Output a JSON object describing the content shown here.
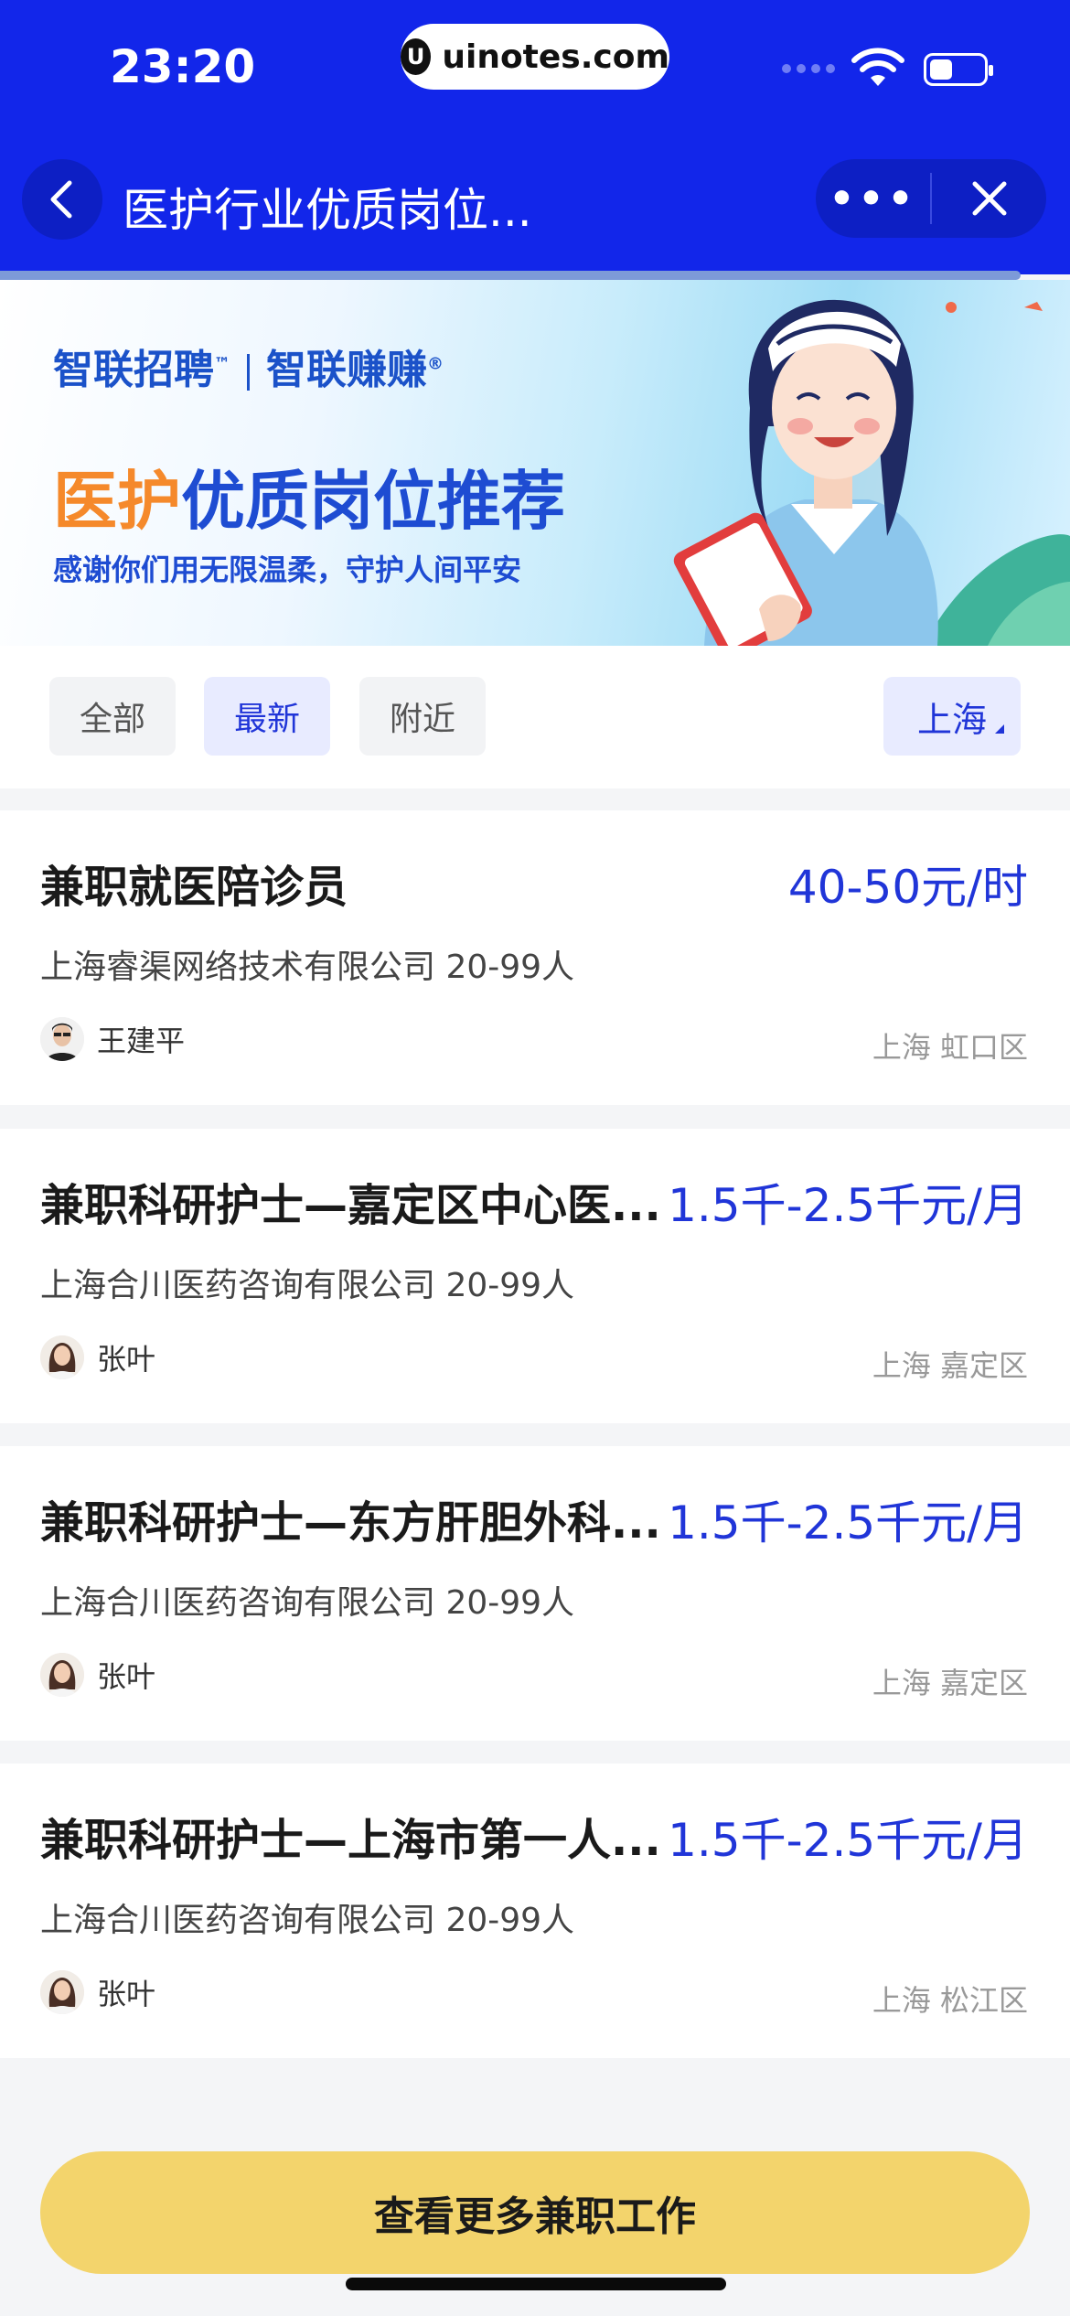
{
  "status_bar": {
    "time": "23:20",
    "url": "uinotes.com",
    "url_logo": "U"
  },
  "nav": {
    "title": "医护行业优质岗位...",
    "more_label": "•••"
  },
  "banner": {
    "logo_left": "智联招聘",
    "logo_left_mark": "™",
    "logo_right": "智联赚赚",
    "logo_right_mark": "®",
    "title_accent": "医护",
    "title_rest": "优质岗位推荐",
    "subtitle": "感谢你们用无限温柔，守护人间平安"
  },
  "filters": {
    "tabs": [
      {
        "label": "全部",
        "active": false
      },
      {
        "label": "最新",
        "active": true
      },
      {
        "label": "附近",
        "active": false
      }
    ],
    "city": "上海"
  },
  "jobs": [
    {
      "title": "兼职就医陪诊员",
      "salary": "40-50元/时",
      "company": "上海睿渠网络技术有限公司  20-99人",
      "recruiter": "王建平",
      "location": "上海 虹口区"
    },
    {
      "title": "兼职科研护士—嘉定区中心医...",
      "salary": "1.5千-2.5千元/月",
      "company": "上海合川医药咨询有限公司  20-99人",
      "recruiter": "张叶",
      "location": "上海 嘉定区"
    },
    {
      "title": "兼职科研护士—东方肝胆外科...",
      "salary": "1.5千-2.5千元/月",
      "company": "上海合川医药咨询有限公司  20-99人",
      "recruiter": "张叶",
      "location": "上海 嘉定区"
    },
    {
      "title": "兼职科研护士—上海市第一人...",
      "salary": "1.5千-2.5千元/月",
      "company": "上海合川医药咨询有限公司  20-99人",
      "recruiter": "张叶",
      "location": "上海 松江区"
    }
  ],
  "bottom": {
    "more_button": "查看更多兼职工作"
  },
  "colors": {
    "brand_blue": "#1226ea",
    "salary_blue": "#2035d8",
    "accent_orange": "#f5892b",
    "button_yellow": "#f3d46c"
  },
  "icons": [
    "back-icon",
    "more-icon",
    "close-icon",
    "wifi-icon",
    "battery-icon",
    "dropdown-triangle-icon"
  ]
}
